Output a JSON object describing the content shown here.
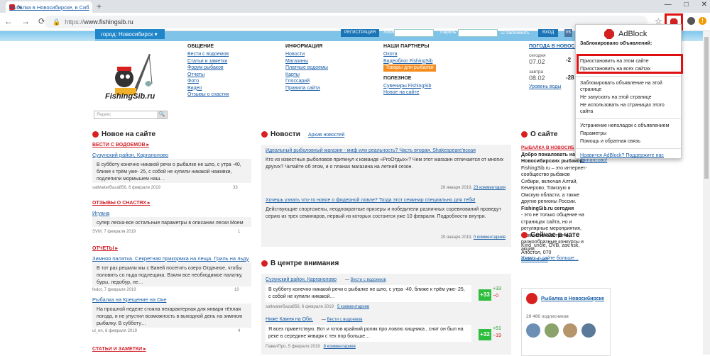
{
  "browser": {
    "tab_title": "Рыбалка в Новосибирске, в Сиб",
    "new_tab": "+",
    "window_controls": [
      "—",
      "□",
      "✕"
    ],
    "url_scheme": "https://",
    "url_host": "www.fishingsib.ru",
    "update_badge": "!"
  },
  "site": {
    "city": "город: Новосибирск",
    "register": "РЕГИСТРАЦИЯ",
    "login_label": "Логин",
    "password_label": "Пароль",
    "remember": "Запомнить",
    "enter": "ВХОД",
    "vk": "VK",
    "logo": "FishingSib.ru",
    "search_placeholder": "Яндекс",
    "search_button": "🔍",
    "menu": {
      "general": {
        "title": "ОБЩЕНИЕ",
        "items": [
          "Вести с водоемов",
          "Статьи и заметки",
          "Форум рыбаков",
          "Отчеты",
          "Фото",
          "Видео",
          "Отзывы о снастях"
        ]
      },
      "info": {
        "title": "ИНФОРМАЦИЯ",
        "items": [
          "Новости",
          "Магазины",
          "Платные водоемы",
          "Карты",
          "Глоссарий",
          "Правила сайта"
        ]
      },
      "partners": {
        "title": "НАШИ ПАРТНЕРЫ",
        "items": [
          "Охота",
          "Видеоблог FishingSib",
          "Товары для рыбалки"
        ]
      },
      "useful": {
        "title": "ПОЛЕЗНОЕ",
        "items": [
          "Сувениры FishingSib",
          "Новое на сайте"
        ]
      }
    },
    "weather": {
      "head": "ПОГОДА В НОВОСИБ",
      "day1": "сегодня",
      "date1": "07.02",
      "t1": "-2",
      "day2": "завтра",
      "date2": "08.02",
      "t2": "-28",
      "water": "Уровень воды"
    },
    "new_on_site": {
      "title": "Новое на сайте",
      "cat1": "ВЕСТИ С ВОДОЕМОВ",
      "item1": {
        "title": "Сузунский район, Карганолово",
        "text": "В субботу конечно никакой речи о рыбалке не шло, с утра -40, ближе к трём уже- 25, с собой не купили никакой наживки, подлепили мормышем наш…",
        "author": "saltwaterBaza856, 6 февраля 2019",
        "count": "33"
      },
      "cat2": "ОТЗЫВЫ О СНАСТЯХ",
      "item2": {
        "title": "Игуана",
        "text": "супер леска-все остальные параметры в описании лески Моем",
        "author": "SVM, 7 февраля 2019",
        "count": "1"
      },
      "cat3": "ОТЧЕТЫ",
      "item3": {
        "title": "Зимняя палатка. Секретная прикормка на леща. Гриль на льду",
        "text": "В тот раз решили мы с Ваней посетить озеро Отдачное, чтобы половить со льда подлещика. Взяли все необходимое палатку, буры, ледобур, не…",
        "author": "fedor, 7 февраля 2019",
        "count": "10"
      },
      "item4": {
        "title": "Рыбалка на Крещение на Оке",
        "text": "На прошлой неделе стояла нехарактерная для января тёплая погода, и не упустил возможность в выходной день на зимнюю рыбалку. В субботу…",
        "author": "ul_en, 6 февраля 2019",
        "count": "4"
      },
      "cat4": "СТАТЬИ И ЗАМЕТКИ"
    },
    "news": {
      "title": "Новости",
      "archive": "Архив новостей",
      "n1": {
        "title": "Идеальный рыболовный магазин - миф или реальность? Часть вторая. Shakespeare'вская",
        "text": "Кто из известных рыболовов приткнул к команде «ProОтдых»? Чем этот магазин отличается от многих других? Читайте об этом, и о планах магазина на летний сезон.",
        "date": "28 января 2019,",
        "comments": "23 комментария"
      },
      "n2": {
        "title": "Хочешь узнать что-то новое о фидерной ловле? Тогда этот семинар специально для тебя!",
        "text": "Действующие спортсмены, неоднократные призеры и победители различных соревнований проведут серию из трех семинаров, первый из которых состоится уже 10 февраля. Подробности внутри.",
        "date": "29 января 2019,",
        "comments": "0 комментариев"
      }
    },
    "focus": {
      "title": "В центре внимания",
      "f1": {
        "title": "Сузунский район, Карганолово",
        "cat": "Вести с водоемов",
        "text": "В субботу конечно никакой речи о рыбалке не шло, с утра -40, ближе к трём уже- 25, с собой не купили никакой…",
        "author": "saltwaterBaza856, 6 февраля 2019",
        "comments": "5 комментариев",
        "score": "+33",
        "plus": "33",
        "minus": "0"
      },
      "f2": {
        "title": "Ниже Камня на Оби.",
        "cat": "Вести с водоемов",
        "text": "Я всех приветствую. Вот и готов крайний ролик про ловлю хищника , снят он был на реке в середине января с тех пор больше…",
        "author": "ПавелПро, 5 февраля 2019",
        "comments": "8 комментариев",
        "score": "+32",
        "plus": "51",
        "minus": "19"
      }
    },
    "about": {
      "title": "О сайте",
      "cat": "РЫБАЛКА В НОВОСИБ",
      "bold": "Добро пожаловать на Новосибирских рыбаков!",
      "text": "FishingSib.ru – это интернет-сообщество рыбаков Сибири, включая Алтай, Кемерово, Томскую и Омскую области, а также другие регионы России.",
      "bold2": "FishingSib.ru сегодня",
      "text2": "- это не только общение на страницах сайта, но и регулярные мероприятия, совместные встречи, разнообразные конкурсы и акции.",
      "more": "Узнать о сайте больше..."
    },
    "chat": {
      "title": "Сейчас в чате",
      "users": "Kind_uncle, OVB, zav.nsk, Апостол, 070",
      "enter": "Войти в чат"
    },
    "vk_widget": {
      "name": "Рыбалка в Новосибирске",
      "subs": "28 466 подписчиков"
    }
  },
  "adblock": {
    "name": "AdBlock",
    "blocked_label": "Заблокировано объявлений:",
    "blocked_value": "",
    "pause_site": "Приостановить на этом сайте",
    "pause_all": "Приостановить на всех сайтах",
    "block_ad": "Заблокировать объявление на этой странице",
    "dont_run_page": "Не запускать на этой странице",
    "dont_use_domain": "Не использовать на страницах этого сайта",
    "troubleshoot": "Устранение неполадок с объявлением",
    "settings": "Параметры",
    "help": "Помощь и обратная связь",
    "like": "Нравится AdBlock? Поддержите нас финансово!"
  }
}
